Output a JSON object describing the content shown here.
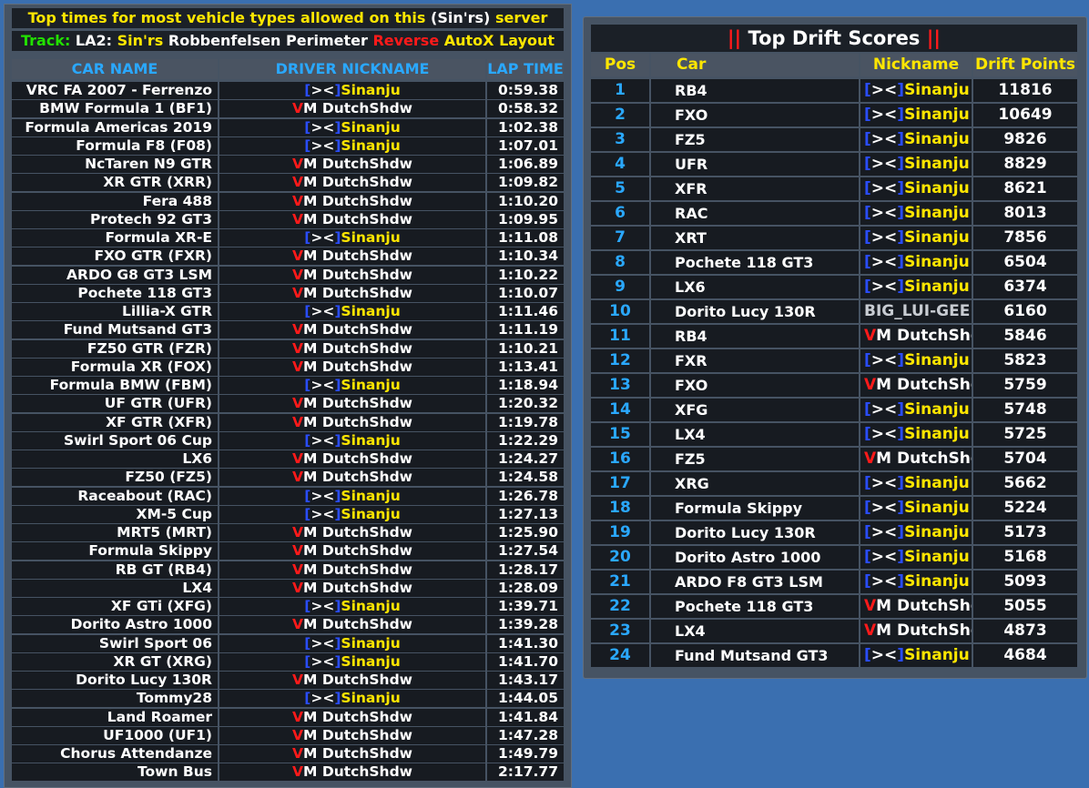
{
  "laptimes": {
    "title_prefix": "Top times for most vehicle types allowed on this",
    "title_server": "(Sin'rs)",
    "title_suffix": "server",
    "track_label": "Track:",
    "track_code": "LA2:",
    "track_owner": "Sin'rs",
    "track_name": "Robbenfelsen Perimeter",
    "track_reverse": "Reverse",
    "track_layout": "AutoX Layout",
    "headers": {
      "car": "CAR NAME",
      "driver": "DRIVER NICKNAME",
      "lap": "LAP TIME"
    },
    "rows": [
      {
        "car": "VRC FA 2007 - Ferrenzo",
        "driver": "S",
        "time": "0:59.38"
      },
      {
        "car": "BMW Formula 1 (BF1)",
        "driver": "D",
        "time": "0:58.32"
      },
      {
        "car": "Formula Americas 2019",
        "driver": "S",
        "time": "1:02.38"
      },
      {
        "car": "Formula F8 (F08)",
        "driver": "S",
        "time": "1:07.01"
      },
      {
        "car": "NcTaren N9 GTR",
        "driver": "D",
        "time": "1:06.89"
      },
      {
        "car": "XR GTR (XRR)",
        "driver": "D",
        "time": "1:09.82"
      },
      {
        "car": "Fera 488",
        "driver": "D",
        "time": "1:10.20"
      },
      {
        "car": "Protech 92 GT3",
        "driver": "D",
        "time": "1:09.95"
      },
      {
        "car": "Formula XR-E",
        "driver": "S",
        "time": "1:11.08"
      },
      {
        "car": "FXO GTR (FXR)",
        "driver": "D",
        "time": "1:10.34"
      },
      {
        "car": "ARDO G8 GT3 LSM",
        "driver": "D",
        "time": "1:10.22"
      },
      {
        "car": "Pochete 118 GT3",
        "driver": "D",
        "time": "1:10.07"
      },
      {
        "car": "Lillia-X GTR",
        "driver": "S",
        "time": "1:11.46"
      },
      {
        "car": "Fund Mutsand GT3",
        "driver": "D",
        "time": "1:11.19"
      },
      {
        "car": "FZ50 GTR (FZR)",
        "driver": "D",
        "time": "1:10.21"
      },
      {
        "car": "Formula XR (FOX)",
        "driver": "D",
        "time": "1:13.41"
      },
      {
        "car": "Formula BMW (FBM)",
        "driver": "S",
        "time": "1:18.94"
      },
      {
        "car": "UF GTR (UFR)",
        "driver": "D",
        "time": "1:20.32"
      },
      {
        "car": "XF GTR (XFR)",
        "driver": "D",
        "time": "1:19.78"
      },
      {
        "car": "Swirl Sport 06 Cup",
        "driver": "S",
        "time": "1:22.29"
      },
      {
        "car": "LX6",
        "driver": "D",
        "time": "1:24.27"
      },
      {
        "car": "FZ50 (FZ5)",
        "driver": "D",
        "time": "1:24.58"
      },
      {
        "car": "Raceabout (RAC)",
        "driver": "S",
        "time": "1:26.78"
      },
      {
        "car": "XM-5 Cup",
        "driver": "S",
        "time": "1:27.13"
      },
      {
        "car": "MRT5 (MRT)",
        "driver": "D",
        "time": "1:25.90"
      },
      {
        "car": "Formula Skippy",
        "driver": "D",
        "time": "1:27.54"
      },
      {
        "car": "RB GT (RB4)",
        "driver": "D",
        "time": "1:28.17"
      },
      {
        "car": "LX4",
        "driver": "D",
        "time": "1:28.09"
      },
      {
        "car": "XF GTi (XFG)",
        "driver": "S",
        "time": "1:39.71"
      },
      {
        "car": "Dorito Astro 1000",
        "driver": "D",
        "time": "1:39.28"
      },
      {
        "car": "Swirl Sport 06",
        "driver": "S",
        "time": "1:41.30"
      },
      {
        "car": "XR GT (XRG)",
        "driver": "S",
        "time": "1:41.70"
      },
      {
        "car": "Dorito Lucy 130R",
        "driver": "D",
        "time": "1:43.17"
      },
      {
        "car": "Tommy28",
        "driver": "S",
        "time": "1:44.05"
      },
      {
        "car": "Land Roamer",
        "driver": "D",
        "time": "1:41.84"
      },
      {
        "car": "UF1000 (UF1)",
        "driver": "D",
        "time": "1:47.28"
      },
      {
        "car": "Chorus Attendanze",
        "driver": "D",
        "time": "1:49.79"
      },
      {
        "car": "Town Bus",
        "driver": "D",
        "time": "2:17.77"
      }
    ]
  },
  "nicknames": {
    "S": {
      "p1": "[",
      "p2": "><",
      "p3": "]",
      "name": "Sinanju"
    },
    "D": {
      "p1": "V",
      "name": "M DutchShdw"
    },
    "B": {
      "name": "BIG_LUI-GEE"
    }
  },
  "drift": {
    "bars": "||",
    "title": "Top Drift Scores",
    "headers": {
      "pos": "Pos",
      "car": "Car",
      "nick": "Nickname",
      "pts": "Drift Points"
    },
    "rows": [
      {
        "pos": "1",
        "car": "RB4",
        "nick": "S",
        "pts": "11816"
      },
      {
        "pos": "2",
        "car": "FXO",
        "nick": "S",
        "pts": "10649"
      },
      {
        "pos": "3",
        "car": "FZ5",
        "nick": "S",
        "pts": "9826"
      },
      {
        "pos": "4",
        "car": "UFR",
        "nick": "S",
        "pts": "8829"
      },
      {
        "pos": "5",
        "car": "XFR",
        "nick": "S",
        "pts": "8621"
      },
      {
        "pos": "6",
        "car": "RAC",
        "nick": "S",
        "pts": "8013"
      },
      {
        "pos": "7",
        "car": "XRT",
        "nick": "S",
        "pts": "7856"
      },
      {
        "pos": "8",
        "car": "Pochete 118 GT3",
        "nick": "S",
        "pts": "6504"
      },
      {
        "pos": "9",
        "car": "LX6",
        "nick": "S",
        "pts": "6374"
      },
      {
        "pos": "10",
        "car": "Dorito Lucy 130R",
        "nick": "B",
        "pts": "6160"
      },
      {
        "pos": "11",
        "car": "RB4",
        "nick": "D",
        "pts": "5846"
      },
      {
        "pos": "12",
        "car": "FXR",
        "nick": "S",
        "pts": "5823"
      },
      {
        "pos": "13",
        "car": "FXO",
        "nick": "D",
        "pts": "5759"
      },
      {
        "pos": "14",
        "car": "XFG",
        "nick": "S",
        "pts": "5748"
      },
      {
        "pos": "15",
        "car": "LX4",
        "nick": "S",
        "pts": "5725"
      },
      {
        "pos": "16",
        "car": "FZ5",
        "nick": "D",
        "pts": "5704"
      },
      {
        "pos": "17",
        "car": "XRG",
        "nick": "S",
        "pts": "5662"
      },
      {
        "pos": "18",
        "car": "Formula Skippy",
        "nick": "S",
        "pts": "5224"
      },
      {
        "pos": "19",
        "car": "Dorito Lucy 130R",
        "nick": "S",
        "pts": "5173"
      },
      {
        "pos": "20",
        "car": "Dorito Astro 1000",
        "nick": "S",
        "pts": "5168"
      },
      {
        "pos": "21",
        "car": "ARDO F8 GT3 LSM",
        "nick": "S",
        "pts": "5093"
      },
      {
        "pos": "22",
        "car": "Pochete 118 GT3",
        "nick": "D",
        "pts": "5055"
      },
      {
        "pos": "23",
        "car": "LX4",
        "nick": "D",
        "pts": "4873"
      },
      {
        "pos": "24",
        "car": "Fund Mutsand GT3",
        "nick": "S",
        "pts": "4684"
      }
    ]
  }
}
